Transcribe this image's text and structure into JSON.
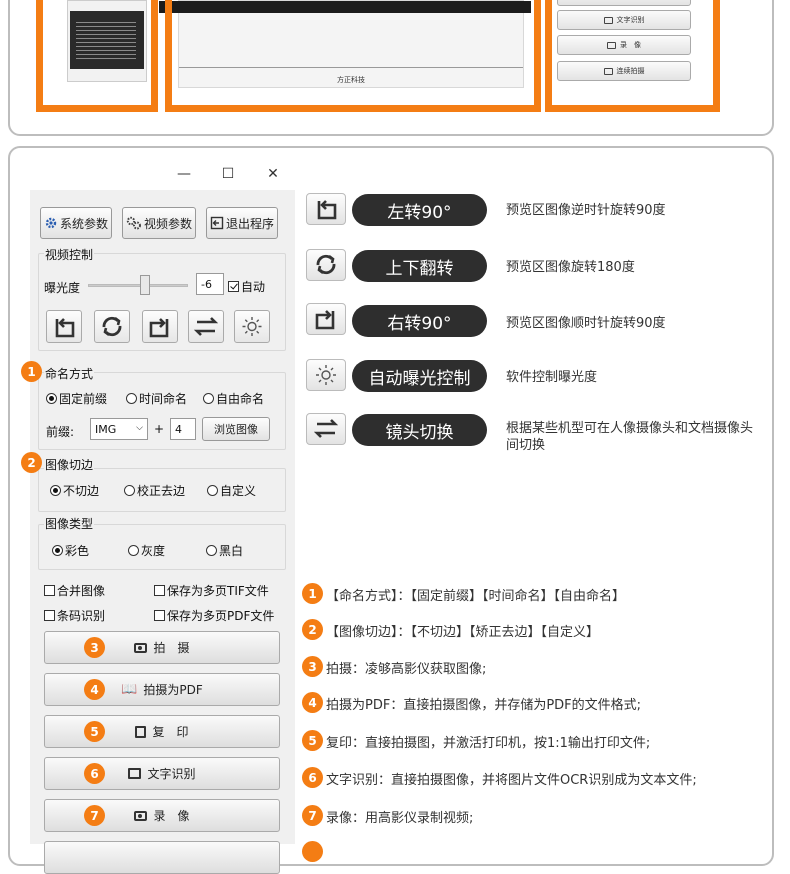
{
  "top_section": {
    "preview_caption": "方正科技",
    "buttons": [
      {
        "label": "文字识别",
        "icon": "ocr-icon"
      },
      {
        "label": "录　像",
        "icon": "camera-icon"
      },
      {
        "label": "连续拍摄",
        "icon": "camera-icon"
      }
    ],
    "frame_color": "#f47d14"
  },
  "app": {
    "window_controls": {
      "minimize": "—",
      "maximize": "☐",
      "close": "✕"
    },
    "toolbar": {
      "system_params": "系统参数",
      "video_params": "视频参数",
      "exit": "退出程序"
    },
    "video_control": {
      "group_label": "视频控制",
      "exposure_label": "曝光度",
      "exposure_value": "-6",
      "auto_label": "自动",
      "auto_checked": true
    },
    "naming": {
      "group_label": "命名方式",
      "options": [
        "固定前缀",
        "时间命名",
        "自由命名"
      ],
      "selected": 0,
      "prefix_label": "前缀:",
      "prefix_value": "IMG",
      "plus": "+",
      "number_value": "4",
      "browse_label": "浏览图像"
    },
    "crop": {
      "group_label": "图像切边",
      "options": [
        "不切边",
        "校正去边",
        "自定义"
      ],
      "selected": 0
    },
    "image_type": {
      "group_label": "图像类型",
      "options": [
        "彩色",
        "灰度",
        "黑白"
      ],
      "selected": 0
    },
    "checkboxes": [
      "合并图像",
      "保存为多页TIF文件",
      "条码识别",
      "保存为多页PDF文件"
    ],
    "action_buttons": [
      {
        "num": "3",
        "label": "拍　摄",
        "icon": "camera-icon"
      },
      {
        "num": "4",
        "label": "拍摄为PDF",
        "icon": "book-icon"
      },
      {
        "num": "5",
        "label": "复　印",
        "icon": "copy-icon"
      },
      {
        "num": "6",
        "label": "文字识别",
        "icon": "ocr-icon"
      },
      {
        "num": "7",
        "label": "录　像",
        "icon": "camera-icon"
      }
    ],
    "group_badges": [
      "1",
      "2"
    ]
  },
  "legend": [
    {
      "pill": "左转90°",
      "desc": "预览区图像逆时针旋转90度",
      "icon": "rotate-left-icon"
    },
    {
      "pill": "上下翻转",
      "desc": "预览区图像旋转180度",
      "icon": "flip-icon"
    },
    {
      "pill": "右转90°",
      "desc": "预览区图像顺时针旋转90度",
      "icon": "rotate-right-icon"
    },
    {
      "pill": "自动曝光控制",
      "desc": "软件控制曝光度",
      "icon": "sun-icon"
    },
    {
      "pill": "镜头切换",
      "desc": "根据某些机型可在人像摄像头和文档摄像头间切换",
      "icon": "switch-camera-icon"
    }
  ],
  "notes": [
    {
      "num": "1",
      "text": "【命名方式】：【固定前缀】【时间命名】【自由命名】"
    },
    {
      "num": "2",
      "text": "【图像切边】：【不切边】【矫正去边】【自定义】"
    },
    {
      "num": "3",
      "text": "拍摄：凌够高影仪获取图像;"
    },
    {
      "num": "4",
      "text": "拍摄为PDF：直接拍摄图像，并存储为PDF的文件格式;"
    },
    {
      "num": "5",
      "text": "复印：直接拍摄图，并激活打印机，按1:1输出打印文件;"
    },
    {
      "num": "6",
      "text": "文字识别：直接拍摄图像，并将图片文件OCR识别成为文本文件;"
    },
    {
      "num": "7",
      "text": "录像：用高影仪录制视频;"
    }
  ]
}
